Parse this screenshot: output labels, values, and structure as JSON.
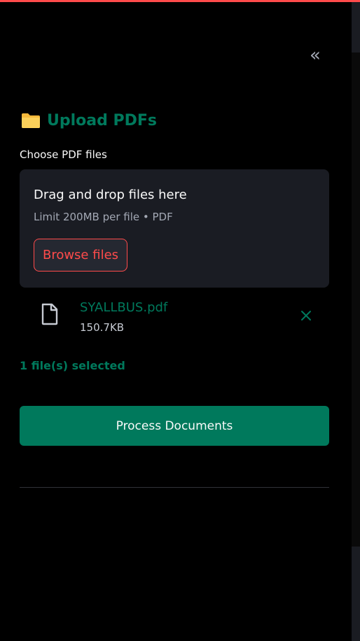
{
  "sidebar": {
    "collapse_glyph": "«",
    "header": {
      "icon": "folder-icon",
      "title": "Upload PDFs"
    },
    "uploader": {
      "label": "Choose PDF files",
      "dropzone_title": "Drag and drop files here",
      "dropzone_limit": "Limit 200MB per file • PDF",
      "browse_label": "Browse files"
    },
    "files": [
      {
        "name": "SYALLBUS.pdf",
        "size": "150.7KB",
        "icon": "file-icon",
        "remove_icon": "close-icon"
      }
    ],
    "selected_text": "1 file(s) selected",
    "process_label": "Process Documents"
  },
  "colors": {
    "background": "#000000",
    "top_accent": "#ff4b4b",
    "primary_green": "#00795c",
    "dropzone_bg": "#1a1c23",
    "browse_accent": "#ff4b4b",
    "text": "#fafafa",
    "muted_text": "#a3a8b4"
  }
}
